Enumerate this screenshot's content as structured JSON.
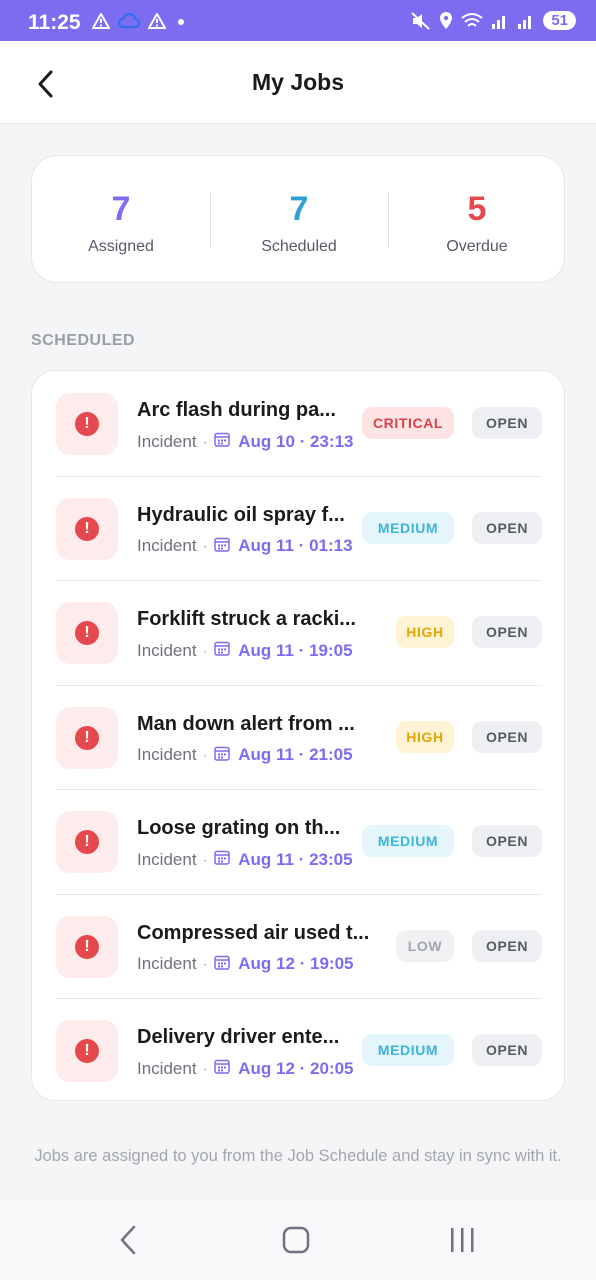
{
  "status_bar": {
    "time": "11:25",
    "battery": "51"
  },
  "header": {
    "title": "My Jobs"
  },
  "stats": [
    {
      "value": "7",
      "label": "Assigned",
      "color": "#7b6cf0"
    },
    {
      "value": "7",
      "label": "Scheduled",
      "color": "#2f9fd6"
    },
    {
      "value": "5",
      "label": "Overdue",
      "color": "#e5484d"
    }
  ],
  "section_label": "SCHEDULED",
  "jobs": [
    {
      "title": "Arc flash during pa...",
      "type": "Incident",
      "date": "Aug 10 · 23:13",
      "severity": "CRITICAL",
      "status": "OPEN"
    },
    {
      "title": "Hydraulic oil spray f...",
      "type": "Incident",
      "date": "Aug 11 · 01:13",
      "severity": "MEDIUM",
      "status": "OPEN"
    },
    {
      "title": "Forklift struck a racki...",
      "type": "Incident",
      "date": "Aug 11 · 19:05",
      "severity": "HIGH",
      "status": "OPEN"
    },
    {
      "title": "Man down alert from ...",
      "type": "Incident",
      "date": "Aug 11 · 21:05",
      "severity": "HIGH",
      "status": "OPEN"
    },
    {
      "title": "Loose grating on th...",
      "type": "Incident",
      "date": "Aug 11 · 23:05",
      "severity": "MEDIUM",
      "status": "OPEN"
    },
    {
      "title": "Compressed air used t...",
      "type": "Incident",
      "date": "Aug 12 · 19:05",
      "severity": "LOW",
      "status": "OPEN"
    },
    {
      "title": "Delivery driver ente...",
      "type": "Incident",
      "date": "Aug 12 · 20:05",
      "severity": "MEDIUM",
      "status": "OPEN"
    }
  ],
  "footer_note": "Jobs are assigned to you from the Job Schedule and stay in sync with it."
}
